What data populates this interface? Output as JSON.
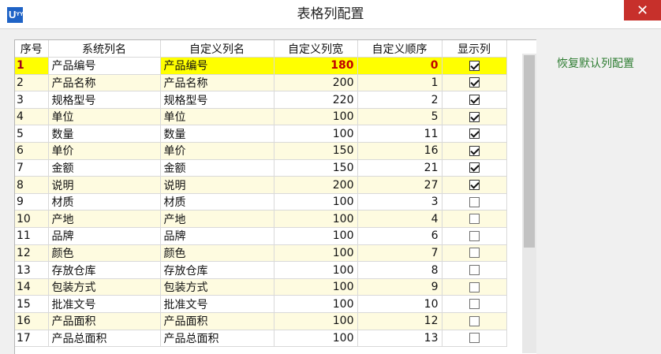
{
  "window": {
    "title": "表格列配置",
    "icon_text": "U",
    "icon_sup": "YY",
    "close_glyph": "✕"
  },
  "columns": [
    "序号",
    "系统列名",
    "自定义列名",
    "自定义列宽",
    "自定义顺序",
    "显示列"
  ],
  "rows": [
    {
      "seq": "1",
      "sys": "产品编号",
      "custom": "产品编号",
      "width": "180",
      "order": "0",
      "show": true
    },
    {
      "seq": "2",
      "sys": "产品名称",
      "custom": "产品名称",
      "width": "200",
      "order": "1",
      "show": true
    },
    {
      "seq": "3",
      "sys": "规格型号",
      "custom": "规格型号",
      "width": "220",
      "order": "2",
      "show": true
    },
    {
      "seq": "4",
      "sys": "单位",
      "custom": "单位",
      "width": "100",
      "order": "5",
      "show": true
    },
    {
      "seq": "5",
      "sys": "数量",
      "custom": "数量",
      "width": "100",
      "order": "11",
      "show": true
    },
    {
      "seq": "6",
      "sys": "单价",
      "custom": "单价",
      "width": "150",
      "order": "16",
      "show": true
    },
    {
      "seq": "7",
      "sys": "金额",
      "custom": "金额",
      "width": "150",
      "order": "21",
      "show": true
    },
    {
      "seq": "8",
      "sys": "说明",
      "custom": "说明",
      "width": "200",
      "order": "27",
      "show": true
    },
    {
      "seq": "9",
      "sys": "材质",
      "custom": "材质",
      "width": "100",
      "order": "3",
      "show": false
    },
    {
      "seq": "10",
      "sys": "产地",
      "custom": "产地",
      "width": "100",
      "order": "4",
      "show": false
    },
    {
      "seq": "11",
      "sys": "品牌",
      "custom": "品牌",
      "width": "100",
      "order": "6",
      "show": false
    },
    {
      "seq": "12",
      "sys": "颜色",
      "custom": "颜色",
      "width": "100",
      "order": "7",
      "show": false
    },
    {
      "seq": "13",
      "sys": "存放仓库",
      "custom": "存放仓库",
      "width": "100",
      "order": "8",
      "show": false
    },
    {
      "seq": "14",
      "sys": "包装方式",
      "custom": "包装方式",
      "width": "100",
      "order": "9",
      "show": false
    },
    {
      "seq": "15",
      "sys": "批准文号",
      "custom": "批准文号",
      "width": "100",
      "order": "10",
      "show": false
    },
    {
      "seq": "16",
      "sys": "产品面积",
      "custom": "产品面积",
      "width": "100",
      "order": "12",
      "show": false
    },
    {
      "seq": "17",
      "sys": "产品总面积",
      "custom": "产品总面积",
      "width": "100",
      "order": "13",
      "show": false
    }
  ],
  "restore_link": "恢复默认列配置",
  "colors": {
    "selected_row": "#ffff00",
    "alt_row": "#fefbe0",
    "close_button": "#c7302b",
    "link": "#2e7d32"
  }
}
